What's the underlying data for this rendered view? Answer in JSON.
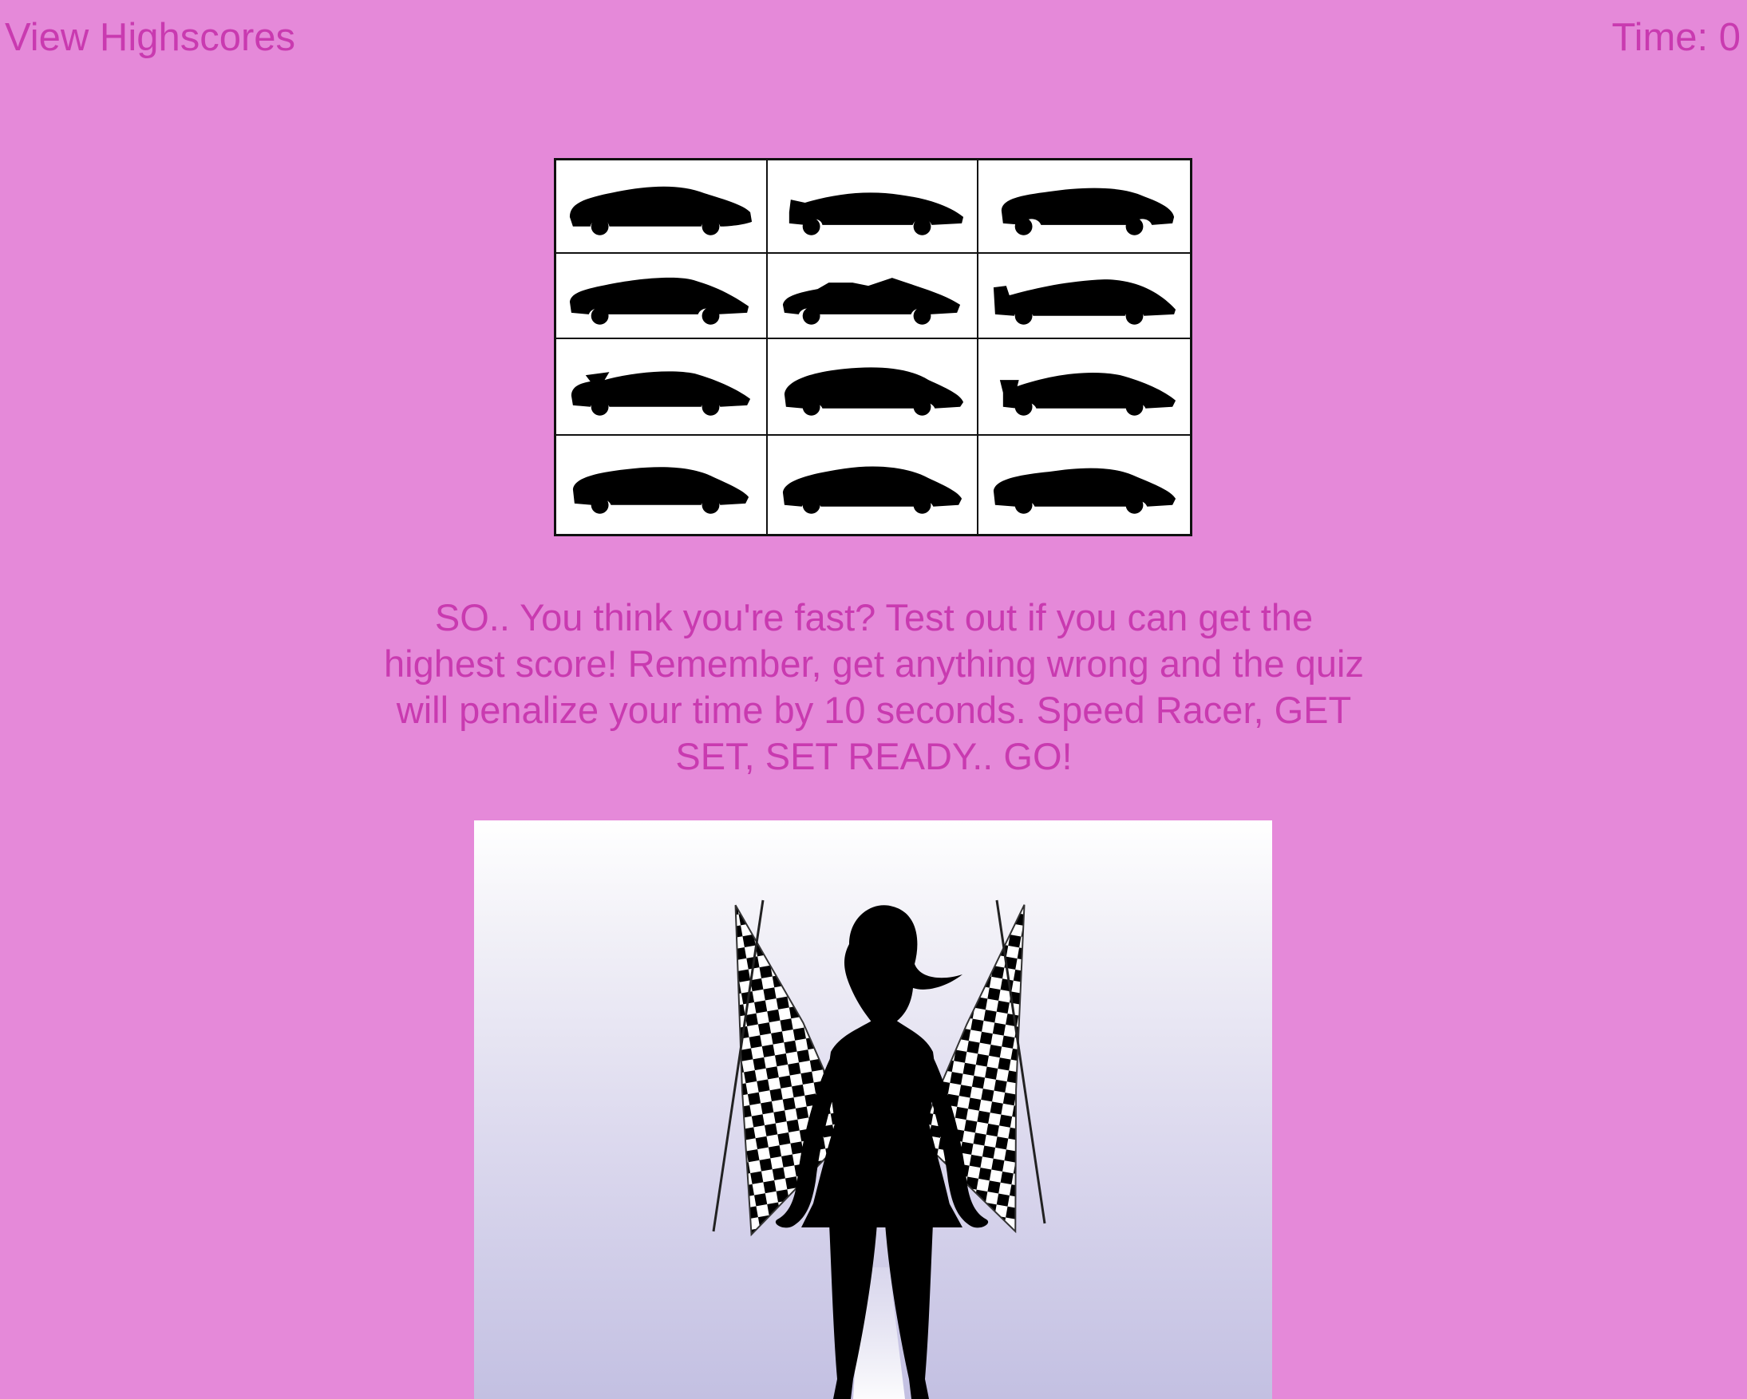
{
  "header": {
    "highscores_link": "View Highscores",
    "timer_label": "Time: 0"
  },
  "car_grid": {
    "rows": 4,
    "columns": 3,
    "icons": [
      "car-silhouette-icon",
      "car-silhouette-icon",
      "car-silhouette-icon",
      "car-silhouette-icon",
      "car-silhouette-icon",
      "car-silhouette-icon",
      "car-silhouette-icon",
      "car-silhouette-icon",
      "car-silhouette-icon",
      "car-silhouette-icon",
      "car-silhouette-icon",
      "car-silhouette-icon"
    ]
  },
  "intro": {
    "text": "SO.. You think you're fast? Test out if you can get the highest score! Remember, get anything wrong and the quiz will penalize your time by 10 seconds. Speed Racer, GET SET, SET READY.. GO!"
  },
  "hero_image": {
    "icon": "race-girl-checkered-flags-icon"
  },
  "colors": {
    "background": "#e589d9",
    "text": "#c93ab0",
    "grid_border": "#111111"
  }
}
